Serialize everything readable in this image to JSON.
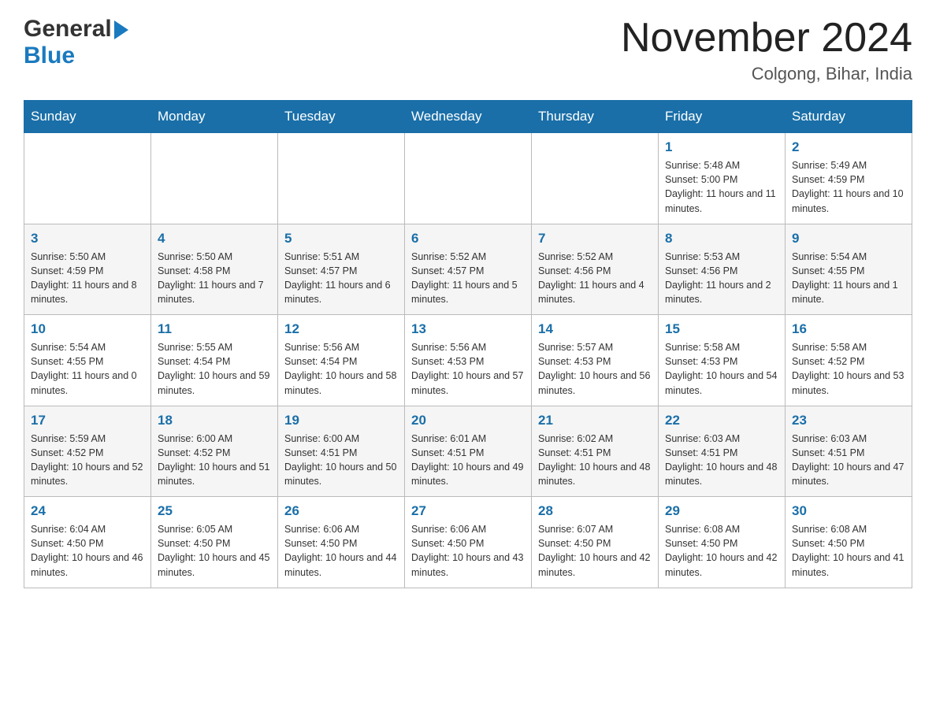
{
  "header": {
    "logo_general": "General",
    "logo_blue": "Blue",
    "month_title": "November 2024",
    "location": "Colgong, Bihar, India"
  },
  "days_of_week": [
    "Sunday",
    "Monday",
    "Tuesday",
    "Wednesday",
    "Thursday",
    "Friday",
    "Saturday"
  ],
  "weeks": [
    [
      {
        "day": "",
        "info": ""
      },
      {
        "day": "",
        "info": ""
      },
      {
        "day": "",
        "info": ""
      },
      {
        "day": "",
        "info": ""
      },
      {
        "day": "",
        "info": ""
      },
      {
        "day": "1",
        "info": "Sunrise: 5:48 AM\nSunset: 5:00 PM\nDaylight: 11 hours and 11 minutes."
      },
      {
        "day": "2",
        "info": "Sunrise: 5:49 AM\nSunset: 4:59 PM\nDaylight: 11 hours and 10 minutes."
      }
    ],
    [
      {
        "day": "3",
        "info": "Sunrise: 5:50 AM\nSunset: 4:59 PM\nDaylight: 11 hours and 8 minutes."
      },
      {
        "day": "4",
        "info": "Sunrise: 5:50 AM\nSunset: 4:58 PM\nDaylight: 11 hours and 7 minutes."
      },
      {
        "day": "5",
        "info": "Sunrise: 5:51 AM\nSunset: 4:57 PM\nDaylight: 11 hours and 6 minutes."
      },
      {
        "day": "6",
        "info": "Sunrise: 5:52 AM\nSunset: 4:57 PM\nDaylight: 11 hours and 5 minutes."
      },
      {
        "day": "7",
        "info": "Sunrise: 5:52 AM\nSunset: 4:56 PM\nDaylight: 11 hours and 4 minutes."
      },
      {
        "day": "8",
        "info": "Sunrise: 5:53 AM\nSunset: 4:56 PM\nDaylight: 11 hours and 2 minutes."
      },
      {
        "day": "9",
        "info": "Sunrise: 5:54 AM\nSunset: 4:55 PM\nDaylight: 11 hours and 1 minute."
      }
    ],
    [
      {
        "day": "10",
        "info": "Sunrise: 5:54 AM\nSunset: 4:55 PM\nDaylight: 11 hours and 0 minutes."
      },
      {
        "day": "11",
        "info": "Sunrise: 5:55 AM\nSunset: 4:54 PM\nDaylight: 10 hours and 59 minutes."
      },
      {
        "day": "12",
        "info": "Sunrise: 5:56 AM\nSunset: 4:54 PM\nDaylight: 10 hours and 58 minutes."
      },
      {
        "day": "13",
        "info": "Sunrise: 5:56 AM\nSunset: 4:53 PM\nDaylight: 10 hours and 57 minutes."
      },
      {
        "day": "14",
        "info": "Sunrise: 5:57 AM\nSunset: 4:53 PM\nDaylight: 10 hours and 56 minutes."
      },
      {
        "day": "15",
        "info": "Sunrise: 5:58 AM\nSunset: 4:53 PM\nDaylight: 10 hours and 54 minutes."
      },
      {
        "day": "16",
        "info": "Sunrise: 5:58 AM\nSunset: 4:52 PM\nDaylight: 10 hours and 53 minutes."
      }
    ],
    [
      {
        "day": "17",
        "info": "Sunrise: 5:59 AM\nSunset: 4:52 PM\nDaylight: 10 hours and 52 minutes."
      },
      {
        "day": "18",
        "info": "Sunrise: 6:00 AM\nSunset: 4:52 PM\nDaylight: 10 hours and 51 minutes."
      },
      {
        "day": "19",
        "info": "Sunrise: 6:00 AM\nSunset: 4:51 PM\nDaylight: 10 hours and 50 minutes."
      },
      {
        "day": "20",
        "info": "Sunrise: 6:01 AM\nSunset: 4:51 PM\nDaylight: 10 hours and 49 minutes."
      },
      {
        "day": "21",
        "info": "Sunrise: 6:02 AM\nSunset: 4:51 PM\nDaylight: 10 hours and 48 minutes."
      },
      {
        "day": "22",
        "info": "Sunrise: 6:03 AM\nSunset: 4:51 PM\nDaylight: 10 hours and 48 minutes."
      },
      {
        "day": "23",
        "info": "Sunrise: 6:03 AM\nSunset: 4:51 PM\nDaylight: 10 hours and 47 minutes."
      }
    ],
    [
      {
        "day": "24",
        "info": "Sunrise: 6:04 AM\nSunset: 4:50 PM\nDaylight: 10 hours and 46 minutes."
      },
      {
        "day": "25",
        "info": "Sunrise: 6:05 AM\nSunset: 4:50 PM\nDaylight: 10 hours and 45 minutes."
      },
      {
        "day": "26",
        "info": "Sunrise: 6:06 AM\nSunset: 4:50 PM\nDaylight: 10 hours and 44 minutes."
      },
      {
        "day": "27",
        "info": "Sunrise: 6:06 AM\nSunset: 4:50 PM\nDaylight: 10 hours and 43 minutes."
      },
      {
        "day": "28",
        "info": "Sunrise: 6:07 AM\nSunset: 4:50 PM\nDaylight: 10 hours and 42 minutes."
      },
      {
        "day": "29",
        "info": "Sunrise: 6:08 AM\nSunset: 4:50 PM\nDaylight: 10 hours and 42 minutes."
      },
      {
        "day": "30",
        "info": "Sunrise: 6:08 AM\nSunset: 4:50 PM\nDaylight: 10 hours and 41 minutes."
      }
    ]
  ]
}
